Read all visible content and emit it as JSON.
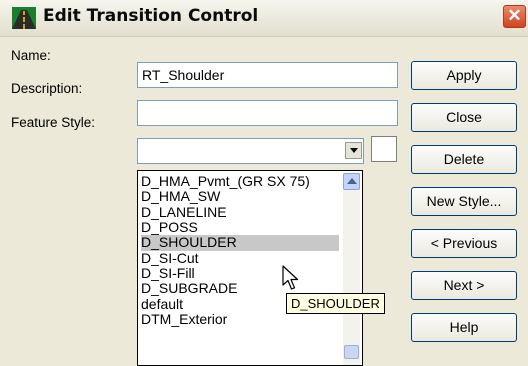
{
  "window": {
    "title": "Edit Transition Control",
    "close_glyph": "✕"
  },
  "form": {
    "name_label": "Name:",
    "name_value": "RT_Shoulder",
    "description_label": "Description:",
    "description_value": "",
    "feature_style_label": "Feature Style:",
    "feature_style_value": ""
  },
  "buttons": {
    "apply": "Apply",
    "close": "Close",
    "delete": "Delete",
    "new_style": "New Style...",
    "previous": "< Previous",
    "next": "Next >",
    "help": "Help"
  },
  "dropdown": {
    "items": [
      "D_HMA_Pvmt_(GR SX 75)",
      "D_HMA_SW",
      "D_LANELINE",
      "D_POSS",
      "D_SHOULDER",
      "D_SI-Cut",
      "D_SI-Fill",
      "D_SUBGRADE",
      "default",
      "DTM_Exterior"
    ],
    "highlighted_index": 4
  },
  "tooltip": {
    "text": "D_SHOULDER"
  },
  "icons": {
    "app": "road-icon",
    "close": "close-icon",
    "combo": "chevron-down-icon",
    "scroll_up": "scroll-up-icon",
    "cursor": "mouse-pointer-icon"
  },
  "colors": {
    "title_close": "#cf4420",
    "highlight": "#c8c8c8",
    "tooltip_bg": "#ffffe1",
    "dialog_bg": "#ece9d8"
  }
}
